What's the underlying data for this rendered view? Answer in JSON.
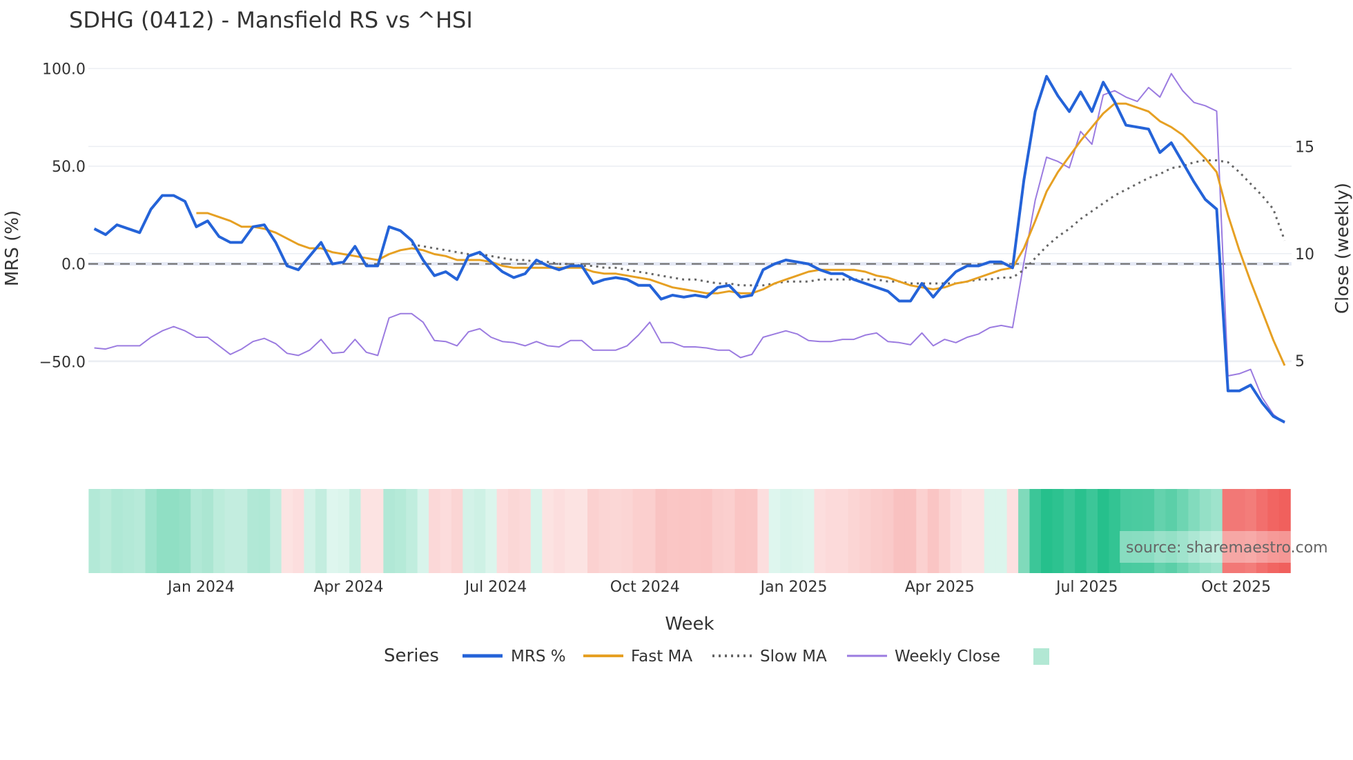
{
  "chart_data": {
    "type": "line",
    "title": "SDHG (0412) - Mansfield RS vs ^HSI",
    "xlabel": "Week",
    "ylabel": "MRS (%)",
    "y2label": "Close (weekly)",
    "ylim": [
      -88,
      104
    ],
    "y2lim": [
      1.5,
      19
    ],
    "yticks": [
      100,
      50,
      0,
      -50
    ],
    "ytick_labels": [
      "100.0",
      "50.0",
      "0.0",
      "−50.0"
    ],
    "y2ticks": [
      15,
      10,
      5
    ],
    "y2tick_labels": [
      "15",
      "10",
      "5"
    ],
    "xticks": [
      "2024-01-01",
      "2024-04-01",
      "2024-07-01",
      "2024-10-01",
      "2025-01-01",
      "2025-04-01",
      "2025-07-01",
      "2025-10-01"
    ],
    "xtick_labels": [
      "Jan 2024",
      "Apr 2024",
      "Jul 2024",
      "Oct 2024",
      "Jan 2025",
      "Apr 2025",
      "Jul 2025",
      "Oct 2025"
    ],
    "grid": true,
    "zero_line": {
      "value": 0,
      "style": "dashed",
      "color": "#666666"
    },
    "legend": {
      "title": "Series",
      "placement": "bottom"
    },
    "source": "source: sharemaestro.com",
    "x": [
      "2023-10-27",
      "2023-11-03",
      "2023-11-10",
      "2023-11-17",
      "2023-11-24",
      "2023-12-01",
      "2023-12-08",
      "2023-12-15",
      "2023-12-22",
      "2023-12-29",
      "2024-01-05",
      "2024-01-12",
      "2024-01-19",
      "2024-01-26",
      "2024-02-02",
      "2024-02-09",
      "2024-02-16",
      "2024-02-23",
      "2024-03-01",
      "2024-03-08",
      "2024-03-15",
      "2024-03-22",
      "2024-03-29",
      "2024-04-05",
      "2024-04-12",
      "2024-04-19",
      "2024-04-26",
      "2024-05-03",
      "2024-05-10",
      "2024-05-17",
      "2024-05-24",
      "2024-05-31",
      "2024-06-07",
      "2024-06-14",
      "2024-06-21",
      "2024-06-28",
      "2024-07-05",
      "2024-07-12",
      "2024-07-19",
      "2024-07-26",
      "2024-08-02",
      "2024-08-09",
      "2024-08-16",
      "2024-08-23",
      "2024-08-30",
      "2024-09-06",
      "2024-09-13",
      "2024-09-20",
      "2024-09-27",
      "2024-10-04",
      "2024-10-11",
      "2024-10-18",
      "2024-10-25",
      "2024-11-01",
      "2024-11-08",
      "2024-11-15",
      "2024-11-22",
      "2024-11-29",
      "2024-12-06",
      "2024-12-13",
      "2024-12-20",
      "2024-12-27",
      "2025-01-03",
      "2025-01-10",
      "2025-01-17",
      "2025-01-24",
      "2025-01-31",
      "2025-02-07",
      "2025-02-14",
      "2025-02-21",
      "2025-02-28",
      "2025-03-07",
      "2025-03-14",
      "2025-03-21",
      "2025-03-28",
      "2025-04-04",
      "2025-04-11",
      "2025-04-18",
      "2025-04-25",
      "2025-05-02",
      "2025-05-09",
      "2025-05-16",
      "2025-05-23",
      "2025-05-30",
      "2025-06-06",
      "2025-06-13",
      "2025-06-20",
      "2025-06-27",
      "2025-07-04",
      "2025-07-11",
      "2025-07-18",
      "2025-07-25",
      "2025-08-01",
      "2025-08-08",
      "2025-08-15",
      "2025-08-22",
      "2025-08-29",
      "2025-09-05",
      "2025-09-12",
      "2025-09-19",
      "2025-09-26",
      "2025-10-03",
      "2025-10-10",
      "2025-10-17",
      "2025-10-24",
      "2025-10-31"
    ],
    "series": [
      {
        "name": "MRS %",
        "axis": "left",
        "color": "#2463d8",
        "style": "solid-thick",
        "values": [
          18,
          15,
          20,
          18,
          16,
          28,
          35,
          35,
          32,
          19,
          22,
          14,
          11,
          11,
          19,
          20,
          11,
          -1,
          -3,
          4,
          11,
          0,
          1,
          9,
          -1,
          -1,
          19,
          17,
          12,
          2,
          -6,
          -4,
          -8,
          4,
          6,
          1,
          -4,
          -7,
          -5,
          2,
          -1,
          -3,
          -1,
          -1,
          -10,
          -8,
          -7,
          -8,
          -11,
          -11,
          -18,
          -16,
          -17,
          -16,
          -17,
          -12,
          -11,
          -17,
          -16,
          -3,
          0,
          2,
          1,
          0,
          -3,
          -5,
          -5,
          -8,
          -10,
          -12,
          -14,
          -19,
          -19,
          -10,
          -17,
          -10,
          -4,
          -1,
          -1,
          1,
          1,
          -2,
          43,
          78,
          96,
          86,
          78,
          88,
          78,
          93,
          83,
          71,
          70,
          69,
          57,
          62,
          52,
          42,
          33,
          28,
          -65,
          -65,
          -62,
          -71,
          -78,
          -81
        ]
      },
      {
        "name": "Fast MA",
        "axis": "left",
        "color": "#e6a023",
        "style": "solid",
        "values": [
          null,
          null,
          null,
          null,
          null,
          null,
          null,
          null,
          null,
          26,
          26,
          24,
          22,
          19,
          19,
          18,
          16,
          13,
          10,
          8,
          8,
          6,
          5,
          4,
          3,
          2,
          5,
          7,
          8,
          7,
          5,
          4,
          2,
          2,
          2,
          1,
          -1,
          -2,
          -2,
          -2,
          -2,
          -2,
          -2,
          -2,
          -4,
          -5,
          -5,
          -6,
          -7,
          -8,
          -10,
          -12,
          -13,
          -14,
          -15,
          -15,
          -14,
          -15,
          -15,
          -13,
          -10,
          -8,
          -6,
          -4,
          -3,
          -3,
          -3,
          -3,
          -4,
          -6,
          -7,
          -9,
          -11,
          -12,
          -13,
          -12,
          -10,
          -9,
          -7,
          -5,
          -3,
          -2,
          8,
          22,
          37,
          47,
          55,
          63,
          70,
          77,
          82,
          82,
          80,
          78,
          73,
          70,
          66,
          60,
          54,
          47,
          25,
          7,
          -9,
          -24,
          -39,
          -52
        ]
      },
      {
        "name": "Slow MA",
        "axis": "left",
        "color": "#666666",
        "style": "dotted",
        "values": [
          null,
          null,
          null,
          null,
          null,
          null,
          null,
          null,
          null,
          null,
          null,
          null,
          null,
          null,
          null,
          null,
          null,
          null,
          null,
          null,
          null,
          null,
          null,
          null,
          null,
          null,
          null,
          null,
          10,
          9,
          8,
          7,
          6,
          5,
          5,
          4,
          3,
          2,
          2,
          1,
          1,
          0,
          0,
          -1,
          -1,
          -2,
          -2,
          -3,
          -4,
          -5,
          -6,
          -7,
          -8,
          -8,
          -9,
          -10,
          -10,
          -11,
          -11,
          -11,
          -10,
          -9,
          -9,
          -9,
          -8,
          -8,
          -8,
          -8,
          -8,
          -8,
          -9,
          -9,
          -10,
          -10,
          -10,
          -10,
          -10,
          -9,
          -8,
          -8,
          -7,
          -7,
          -3,
          3,
          9,
          14,
          18,
          23,
          27,
          31,
          35,
          38,
          41,
          44,
          46,
          49,
          50,
          52,
          53,
          53,
          52,
          47,
          41,
          35,
          28,
          12
        ]
      },
      {
        "name": "Weekly Close",
        "axis": "right",
        "color": "#9b7be0",
        "style": "solid-thin",
        "values": [
          5.6,
          5.55,
          5.7,
          5.7,
          5.7,
          6.1,
          6.4,
          6.6,
          6.4,
          6.1,
          6.1,
          5.7,
          5.3,
          5.55,
          5.9,
          6.05,
          5.8,
          5.35,
          5.25,
          5.5,
          6.0,
          5.35,
          5.4,
          6.0,
          5.4,
          5.25,
          7.0,
          7.2,
          7.2,
          6.8,
          5.95,
          5.9,
          5.7,
          6.35,
          6.5,
          6.1,
          5.9,
          5.85,
          5.7,
          5.9,
          5.7,
          5.65,
          5.95,
          5.95,
          5.5,
          5.5,
          5.5,
          5.7,
          6.2,
          6.8,
          5.85,
          5.85,
          5.65,
          5.65,
          5.6,
          5.5,
          5.5,
          5.15,
          5.3,
          6.1,
          6.25,
          6.4,
          6.25,
          5.95,
          5.9,
          5.9,
          6.0,
          6.0,
          6.2,
          6.3,
          5.9,
          5.85,
          5.75,
          6.3,
          5.7,
          6.0,
          5.85,
          6.1,
          6.25,
          6.55,
          6.65,
          6.55,
          9.6,
          12.5,
          14.5,
          14.3,
          14.0,
          15.7,
          15.1,
          17.4,
          17.6,
          17.3,
          17.1,
          17.75,
          17.3,
          18.4,
          17.6,
          17.05,
          16.9,
          16.65,
          4.3,
          4.4,
          4.6,
          3.3,
          2.5,
          2.1
        ]
      }
    ],
    "strip": {
      "type": "heatmap",
      "source_series": "MRS %",
      "positive_color": "#26c08c",
      "negative_color": "#ef5350",
      "legend_swatch_color": "#b2e8d4"
    }
  }
}
